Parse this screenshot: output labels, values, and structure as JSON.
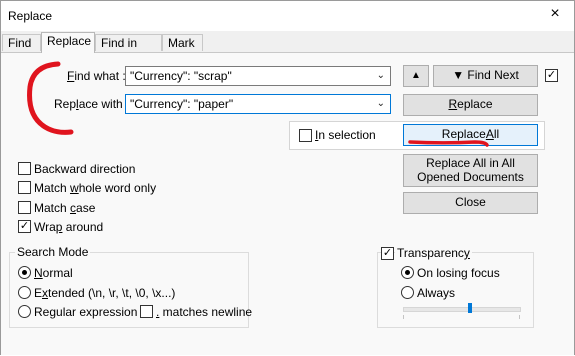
{
  "window": {
    "title": "Replace",
    "close_icon": "×"
  },
  "tabs": [
    "Find",
    "Replace",
    "Find in Files",
    "Mark"
  ],
  "find_what": {
    "label_pre": "F",
    "label_post": "ind what :",
    "value": "\"Currency\": \"scrap\""
  },
  "replace_with": {
    "label_pre": "Rep",
    "label_u": "l",
    "label_post": "ace with :",
    "value": "\"Currency\": \"paper\""
  },
  "buttons": {
    "up_arrow": "▲",
    "find_next": "▼ Find Next",
    "replace_u": "R",
    "replace_rest": "eplace",
    "replace_all_pre": "Replace ",
    "replace_all_u": "A",
    "replace_all_post": "ll",
    "replace_all_opened": "Replace All in All Opened Documents",
    "close": "Close"
  },
  "in_selection": {
    "label_pre": "I",
    "label_post": "n selection",
    "checked": false
  },
  "options": {
    "backward": {
      "label": "Backward direction",
      "checked": false
    },
    "whole_word_pre": "Match ",
    "whole_word_u": "w",
    "whole_word_post": "hole word only",
    "whole_word_checked": false,
    "match_case_pre": "Match ",
    "match_case_u": "c",
    "match_case_post": "ase",
    "match_case_checked": false,
    "wrap_pre": "Wra",
    "wrap_u": "p",
    "wrap_post": " around",
    "wrap_checked": true
  },
  "search_mode": {
    "title": "Search Mode",
    "normal_u": "N",
    "normal_rest": "ormal",
    "extended_pre": "E",
    "extended_u": "x",
    "extended_post": "tended (\\n, \\r, \\t, \\0, \\x...)",
    "regex_pre": "Re",
    "regex_u": "g",
    "regex_post": "ular expression",
    "matches_newline_u": ".",
    "matches_newline_post": " matches newline",
    "selected": "normal"
  },
  "transparency": {
    "label_pre": "Transparenc",
    "label_u": "y",
    "checked": true,
    "on_losing_focus": "On losing focus",
    "always": "Always",
    "selected": "on_losing_focus",
    "slider_fraction": 0.58
  },
  "annotation_color": "#e0141e",
  "check_mark": "✓"
}
